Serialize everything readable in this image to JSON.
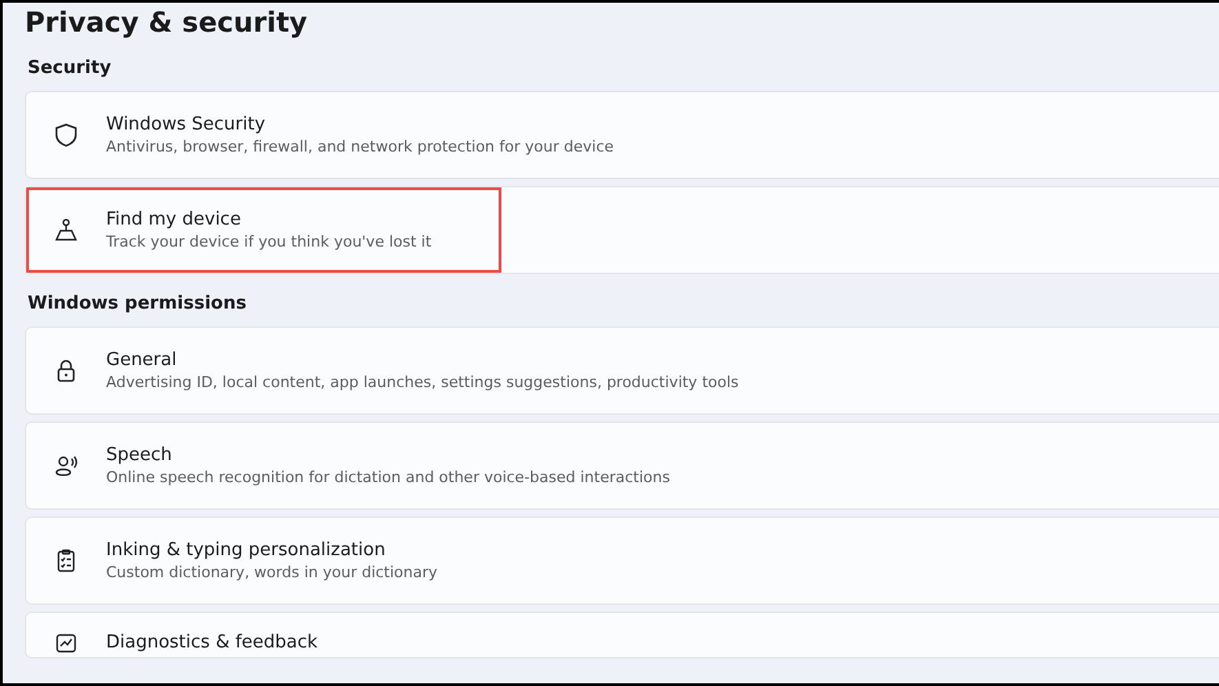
{
  "page_title": "Privacy & security",
  "sections": [
    {
      "heading": "Security",
      "items": [
        {
          "title": "Windows Security",
          "description": "Antivirus, browser, firewall, and network protection for your device",
          "highlighted": false
        },
        {
          "title": "Find my device",
          "description": "Track your device if you think you've lost it",
          "highlighted": true
        }
      ]
    },
    {
      "heading": "Windows permissions",
      "items": [
        {
          "title": "General",
          "description": "Advertising ID, local content, app launches, settings suggestions, productivity tools",
          "highlighted": false
        },
        {
          "title": "Speech",
          "description": "Online speech recognition for dictation and other voice-based interactions",
          "highlighted": false
        },
        {
          "title": "Inking & typing personalization",
          "description": "Custom dictionary, words in your dictionary",
          "highlighted": false
        },
        {
          "title": "Diagnostics & feedback",
          "highlighted": false
        }
      ]
    }
  ]
}
